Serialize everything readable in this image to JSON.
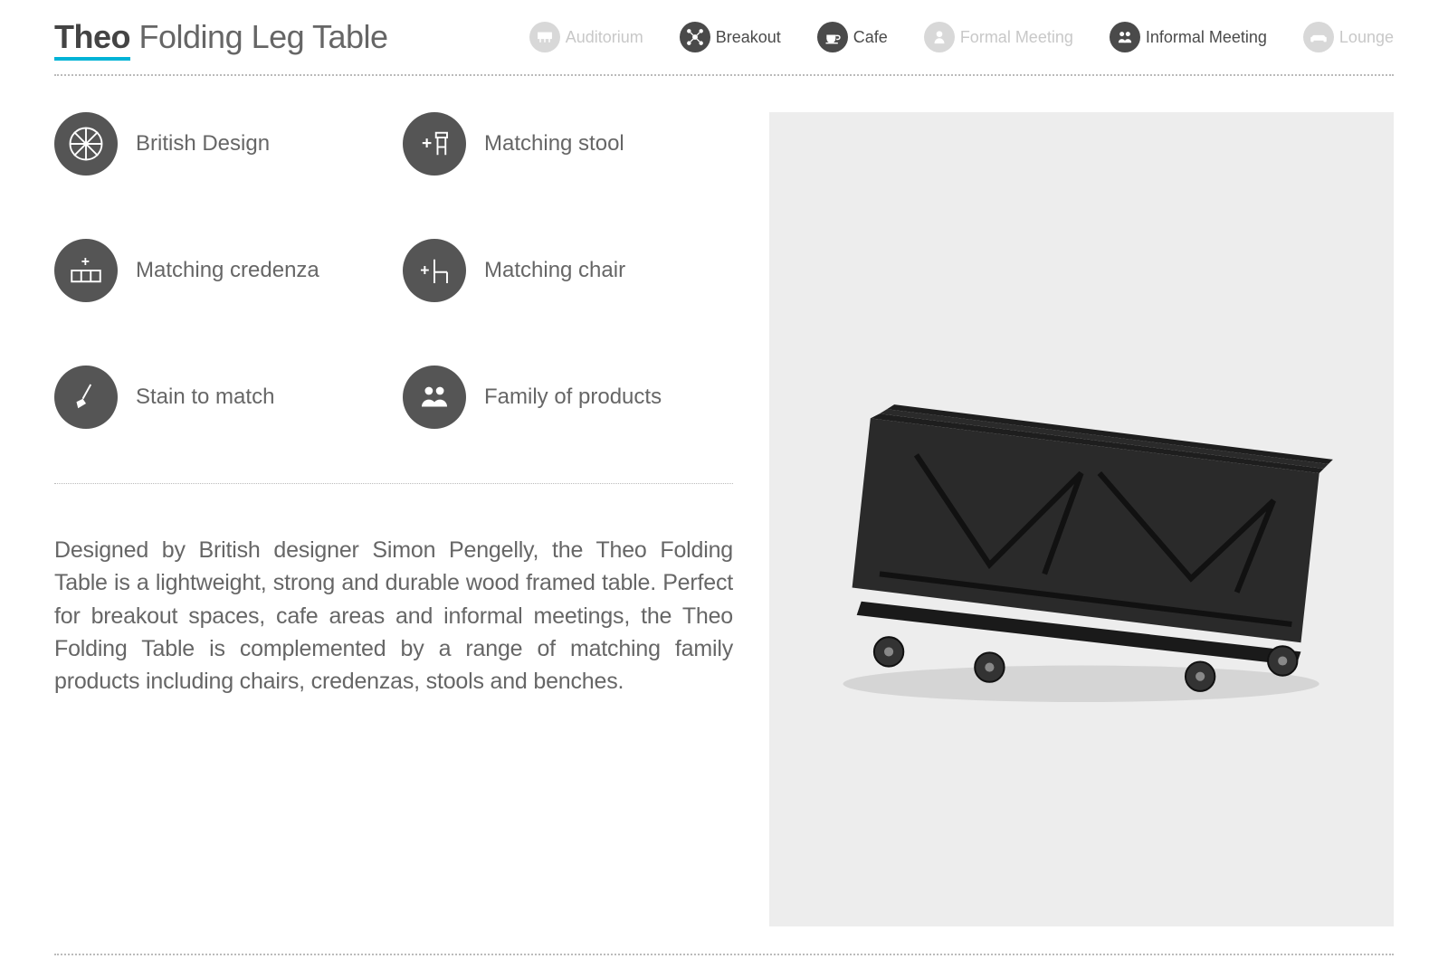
{
  "header": {
    "brand": "Theo",
    "title_rest": "Folding Leg Table"
  },
  "nav": [
    {
      "label": "Auditorium",
      "active": false
    },
    {
      "label": "Breakout",
      "active": true
    },
    {
      "label": "Cafe",
      "active": true
    },
    {
      "label": "Formal Meeting",
      "active": false
    },
    {
      "label": "Informal Meeting",
      "active": true
    },
    {
      "label": "Lounge",
      "active": false
    }
  ],
  "features": [
    {
      "label": "British Design",
      "icon": "british-design-icon"
    },
    {
      "label": "Matching stool",
      "icon": "stool-icon"
    },
    {
      "label": "Matching credenza",
      "icon": "credenza-icon"
    },
    {
      "label": "Matching chair",
      "icon": "chair-icon"
    },
    {
      "label": "Stain to match",
      "icon": "brush-icon"
    },
    {
      "label": "Family of products",
      "icon": "family-icon"
    }
  ],
  "description": "Designed by British designer Simon Pengelly, the Theo Folding Table is a lightweight, strong and durable wood framed table. Perfect for breakout spaces, cafe areas and informal meetings, the Theo Folding Table is complemented by a range of matching family products including chairs, credenzas, stools and benches."
}
